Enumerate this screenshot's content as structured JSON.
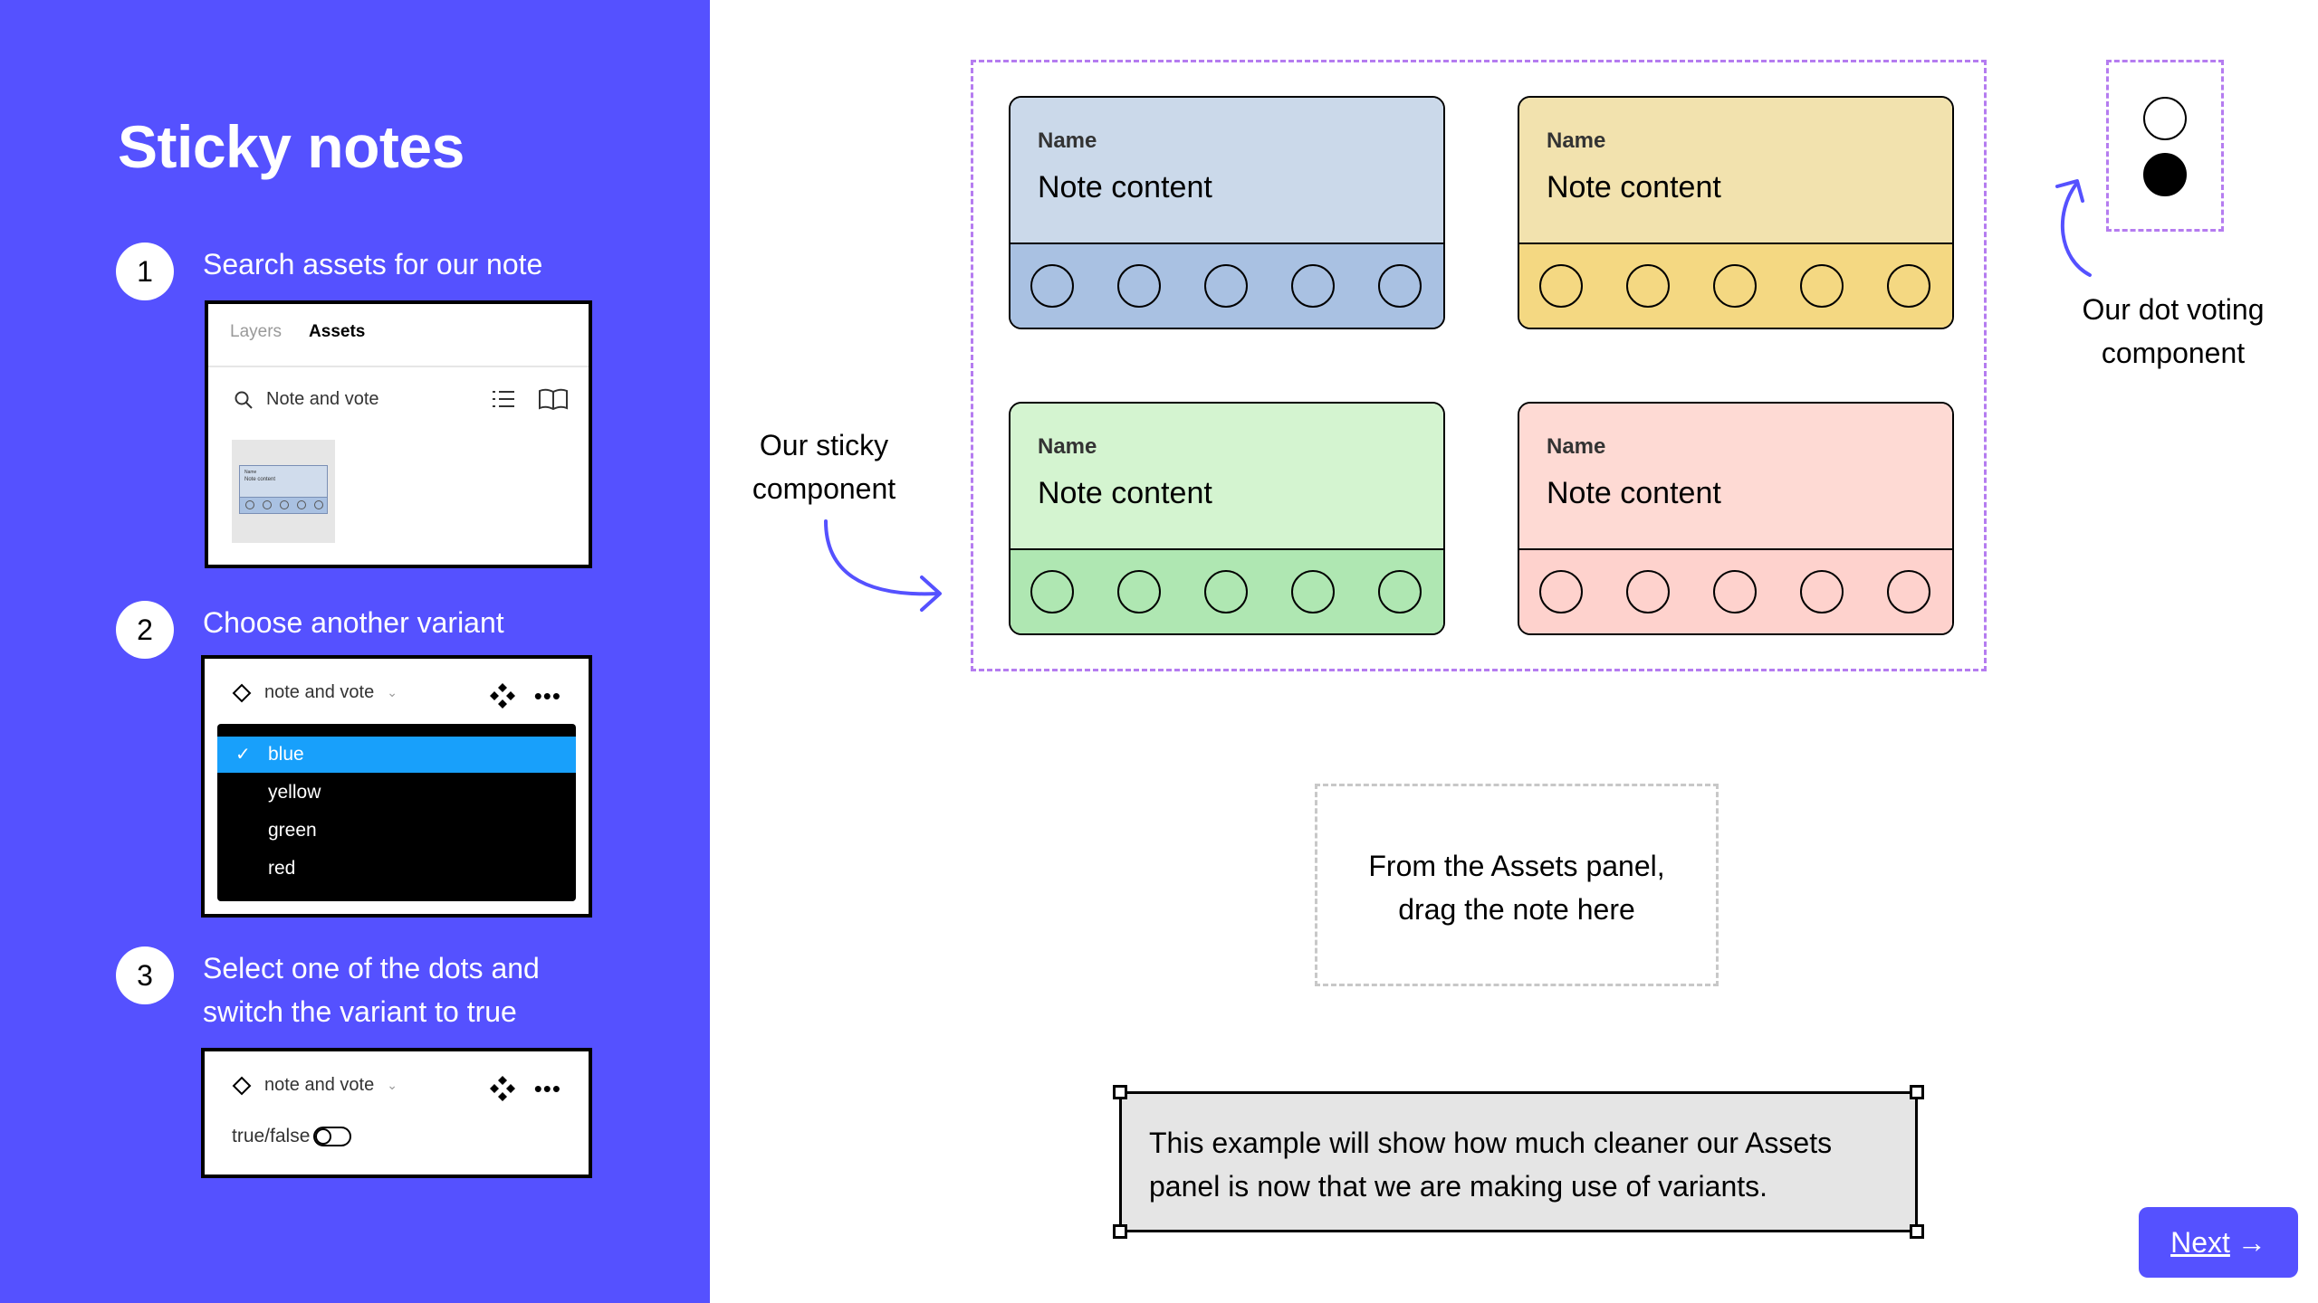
{
  "sidebar": {
    "title": "Sticky notes",
    "steps": [
      {
        "number": "1",
        "text": "Search assets for our note"
      },
      {
        "number": "2",
        "text": "Choose another variant"
      },
      {
        "number": "3",
        "line1": "Select one of the dots and",
        "line2": "switch the variant to true"
      }
    ],
    "assets_panel": {
      "tab_layers": "Layers",
      "tab_assets": "Assets",
      "search_value": "Note and vote",
      "thumb_name": "Name",
      "thumb_content": "Note content"
    },
    "variant_panel": {
      "instance_name": "note and vote",
      "options": [
        "blue",
        "yellow",
        "green",
        "red"
      ],
      "selected": "blue"
    },
    "property_panel": {
      "instance_name": "note and vote",
      "property_label": "true/false",
      "property_value": false
    }
  },
  "notes": [
    {
      "name": "Name",
      "content": "Note content",
      "top_color": "#cbd9ea",
      "bottom_color": "#a9c1e2"
    },
    {
      "name": "Name",
      "content": "Note content",
      "top_color": "#f2e2ae",
      "bottom_color": "#f4d882"
    },
    {
      "name": "Name",
      "content": "Note content",
      "top_color": "#d4f4d0",
      "bottom_color": "#afe7b2"
    },
    {
      "name": "Name",
      "content": "Note content",
      "top_color": "#fedad4",
      "bottom_color": "#fed2cd"
    }
  ],
  "labels": {
    "sticky_line1": "Our sticky",
    "sticky_line2": "component",
    "dot_line1": "Our dot voting",
    "dot_line2": "component"
  },
  "drop_zone": {
    "line1": "From the Assets panel,",
    "line2": "drag the note here"
  },
  "callout": {
    "line1": "This example will show how much cleaner our Assets",
    "line2": "panel is now that we are making use of variants."
  },
  "next_button": {
    "label": "Next",
    "arrow": "→"
  },
  "colors": {
    "brand": "#5551ff",
    "frame_dashed": "#b57cf0",
    "selected_option": "#18a0fb"
  }
}
